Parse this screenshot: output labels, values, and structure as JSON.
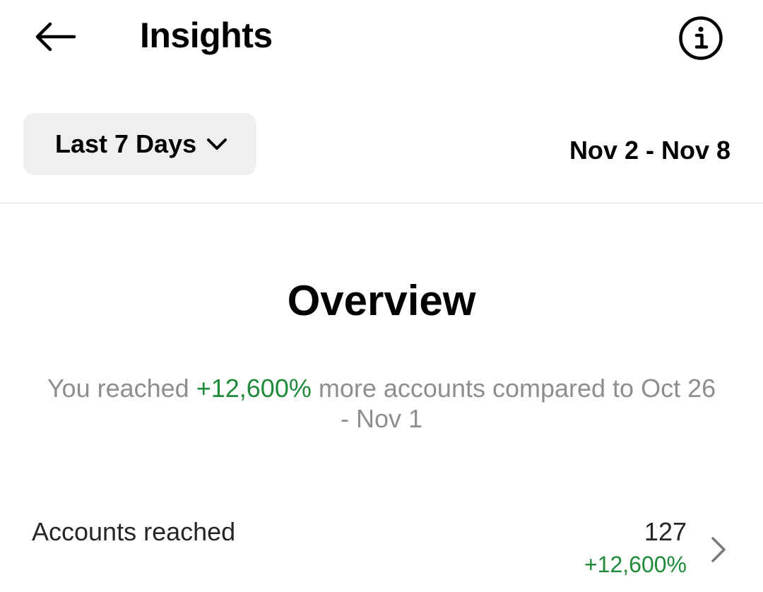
{
  "header": {
    "title": "Insights",
    "back_icon": "arrow-left-icon",
    "info_icon": "info-icon"
  },
  "range": {
    "selected": "Last 7 Days",
    "dropdown_icon": "chevron-down-icon",
    "dates": "Nov 2 - Nov 8"
  },
  "overview": {
    "title": "Overview",
    "summary_prefix": "You reached ",
    "summary_change": "+12,600%",
    "summary_suffix": " more accounts compared to Oct 26 - Nov 1"
  },
  "metrics": [
    {
      "label": "Accounts reached",
      "value": "127",
      "change": "+12,600%",
      "icon": "chevron-right-icon"
    }
  ],
  "colors": {
    "positive": "#1f8a3a",
    "muted_text": "#8e8e8e",
    "chip_bg": "#efefef",
    "divider": "#dbdbdb"
  }
}
